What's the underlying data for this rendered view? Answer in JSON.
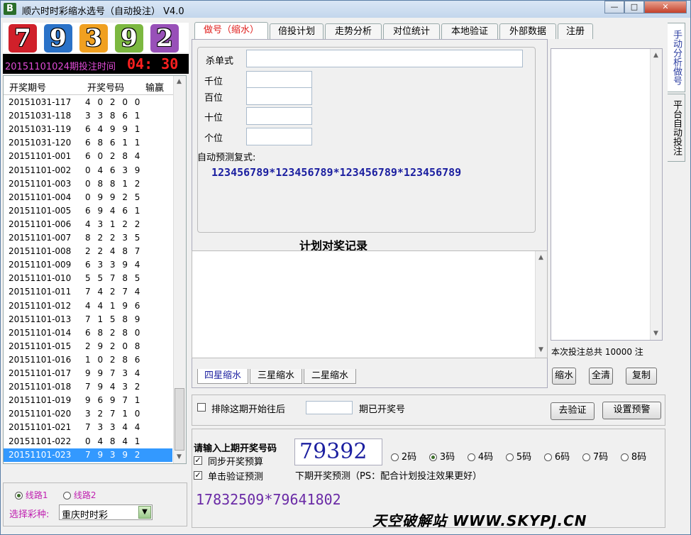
{
  "window": {
    "title": "顺六时时彩缩水选号（自动投注） V4.0",
    "icon_letter": "B",
    "min_label": "—",
    "max_label": "□",
    "close_label": "✕"
  },
  "draw": {
    "digits": [
      {
        "d": "7",
        "color": "#d0202a"
      },
      {
        "d": "9",
        "color": "#2a72c8"
      },
      {
        "d": "3",
        "color": "#f0a020"
      },
      {
        "d": "9",
        "color": "#7cb840"
      },
      {
        "d": "2",
        "color": "#9850b8"
      }
    ],
    "period_label": "20151101024期投注时间",
    "countdown": "04: 30"
  },
  "history": {
    "headers": [
      "开奖期号",
      "开奖号码",
      "输赢"
    ],
    "rows": [
      {
        "period": "20151031-117",
        "nums": "4 0 2 0 0"
      },
      {
        "period": "20151031-118",
        "nums": "3 3 8 6 1"
      },
      {
        "period": "20151031-119",
        "nums": "6 4 9 9 1"
      },
      {
        "period": "20151031-120",
        "nums": "6 8 6 1 1"
      },
      {
        "period": "20151101-001",
        "nums": "6 0 2 8 4"
      },
      {
        "period": "20151101-002",
        "nums": "0 4 6 3 9"
      },
      {
        "period": "20151101-003",
        "nums": "0 8 8 1 2"
      },
      {
        "period": "20151101-004",
        "nums": "0 9 9 2 5"
      },
      {
        "period": "20151101-005",
        "nums": "6 9 4 6 1"
      },
      {
        "period": "20151101-006",
        "nums": "4 3 1 2 2"
      },
      {
        "period": "20151101-007",
        "nums": "8 2 2 3 5"
      },
      {
        "period": "20151101-008",
        "nums": "2 2 4 8 7"
      },
      {
        "period": "20151101-009",
        "nums": "6 3 3 9 4"
      },
      {
        "period": "20151101-010",
        "nums": "5 5 7 8 5"
      },
      {
        "period": "20151101-011",
        "nums": "7 4 2 7 4"
      },
      {
        "period": "20151101-012",
        "nums": "4 4 1 9 6"
      },
      {
        "period": "20151101-013",
        "nums": "7 1 5 8 9"
      },
      {
        "period": "20151101-014",
        "nums": "6 8 2 8 0"
      },
      {
        "period": "20151101-015",
        "nums": "2 9 2 0 8"
      },
      {
        "period": "20151101-016",
        "nums": "1 0 2 8 6"
      },
      {
        "period": "20151101-017",
        "nums": "9 9 7 3 4"
      },
      {
        "period": "20151101-018",
        "nums": "7 9 4 3 2"
      },
      {
        "period": "20151101-019",
        "nums": "9 6 9 7 1"
      },
      {
        "period": "20151101-020",
        "nums": "3 2 7 1 0"
      },
      {
        "period": "20151101-021",
        "nums": "7 3 3 4 4"
      },
      {
        "period": "20151101-022",
        "nums": "0 4 8 4 1"
      },
      {
        "period": "20151101-023",
        "nums": "7 9 3 9 2"
      }
    ]
  },
  "line": {
    "route1": "线路1",
    "route2": "线路2",
    "select_label": "选择彩种:",
    "lottery": "重庆时时彩"
  },
  "tabs": [
    "做号（缩水）",
    "倍投计划",
    "走势分析",
    "对位统计",
    "本地验证",
    "外部数据",
    "注册"
  ],
  "form": {
    "kill": "杀单式",
    "qian": "千位",
    "bai": "百位",
    "shi": "十位",
    "ge": "个位",
    "auto_label": "自动预测复式:",
    "formula": "123456789*123456789*123456789*123456789"
  },
  "record_title": "计划对奖记录",
  "subtabs": [
    "四星缩水",
    "三星缩水",
    "二星缩水"
  ],
  "right": {
    "total": "本次投注总共 10000 注",
    "shrink": "缩水",
    "clear": "全清",
    "copy": "复制"
  },
  "vtabs": [
    "手动分析做号",
    "平台自动投注"
  ],
  "verify": {
    "exclude_label": "排除这期开始往后",
    "opened_label": "期已开奖号",
    "verify_btn": "去验证",
    "warn_btn": "设置预警"
  },
  "bottom": {
    "input_label": "请输入上期开奖号码",
    "last_number": "79392",
    "sync_label": "同步开奖预算",
    "single_label": "单击验证预测",
    "options": [
      "2码",
      "3码",
      "4码",
      "5码",
      "6码",
      "7码",
      "8码"
    ],
    "next_label": "下期开奖预测（PS：配合计划投注效果更好）",
    "prediction": "17832509*79641802",
    "watermark": "天空破解站 WWW.SKYPJ.CN"
  }
}
